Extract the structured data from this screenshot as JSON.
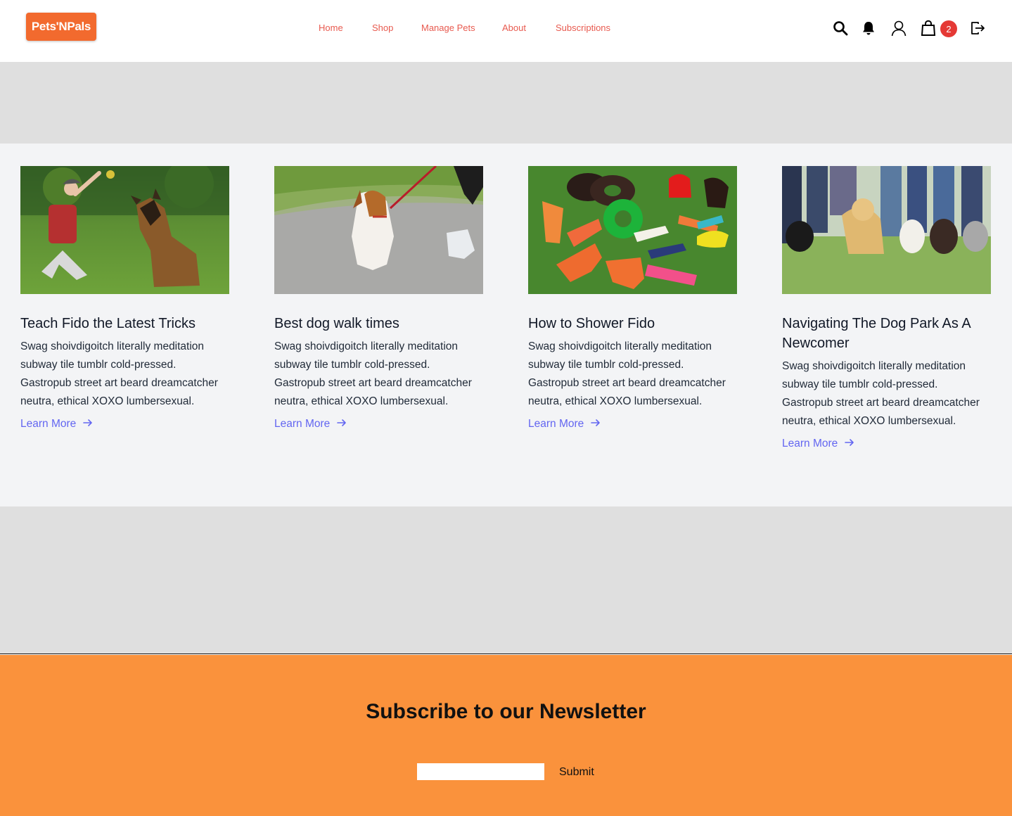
{
  "brand": {
    "logo_text": "Pets'NPals",
    "logo_color": "#f26a2e"
  },
  "nav": {
    "items": [
      {
        "label": "Home"
      },
      {
        "label": "Shop"
      },
      {
        "label": "Manage Pets"
      },
      {
        "label": "About"
      },
      {
        "label": "Subscriptions"
      }
    ],
    "color": "#e85a4f"
  },
  "header_icons": {
    "search": "search-icon",
    "notifications": "bell-icon",
    "account": "user-icon",
    "cart": "shopping-bag-icon",
    "cart_count": "2",
    "logout": "logout-icon"
  },
  "blog": {
    "posts": [
      {
        "image": "woman-training-german-shepherd-photo",
        "title": "Teach Fido the Latest Tricks",
        "text": "Swag shoivdigoitch literally meditation subway tile tumblr cold-pressed. Gastropub street art beard dreamcatcher neutra, ethical XOXO lumbersexual.",
        "link": "Learn More"
      },
      {
        "image": "dog-walking-on-leash-photo",
        "title": "Best dog walk times",
        "text": "Swag shoivdigoitch literally meditation subway tile tumblr cold-pressed. Gastropub street art beard dreamcatcher neutra, ethical XOXO lumbersexual.",
        "link": "Learn More"
      },
      {
        "image": "dog-chew-toys-on-grass-photo",
        "title": "How to Shower Fido",
        "text": "Swag shoivdigoitch literally meditation subway tile tumblr cold-pressed. Gastropub street art beard dreamcatcher neutra, ethical XOXO lumbersexual.",
        "link": "Learn More"
      },
      {
        "image": "dogs-with-owners-at-park-photo",
        "title": "Navigating The Dog Park As A Newcomer",
        "text": "Swag shoivdigoitch literally meditation subway tile tumblr cold-pressed. Gastropub street art beard dreamcatcher neutra, ethical XOXO lumbersexual.",
        "link": "Learn More"
      }
    ],
    "link_color": "#6366f1"
  },
  "newsletter": {
    "title": "Subscribe to our Newsletter",
    "input_value": "",
    "submit_label": "Submit",
    "background": "#fa923c"
  }
}
